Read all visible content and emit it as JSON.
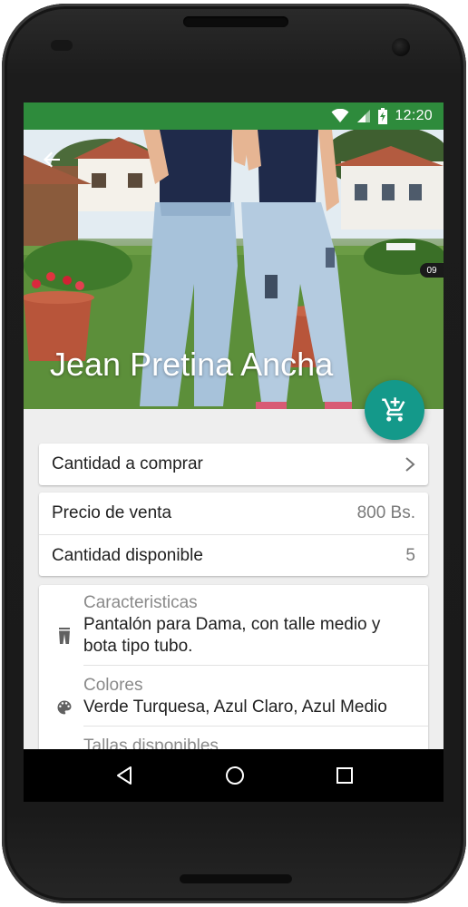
{
  "status_bar": {
    "time": "12:20",
    "icons": [
      "wifi-icon",
      "cell-signal-icon",
      "battery-charging-icon"
    ]
  },
  "product": {
    "title": "Jean Pretina Ancha",
    "photo_counter": "09"
  },
  "purchase": {
    "quantity_label": "Cantidad a comprar"
  },
  "pricing": {
    "price_label": "Precio de venta",
    "price_value": "800 Bs.",
    "stock_label": "Cantidad disponible",
    "stock_value": "5"
  },
  "features": [
    {
      "label": "Caracteristicas",
      "text": "Pantalón para Dama, con talle medio y bota tipo tubo.",
      "icon": "pants-icon"
    },
    {
      "label": "Colores",
      "text": "Verde Turquesa, Azul Claro, Azul Medio",
      "icon": "palette-icon"
    },
    {
      "label": "Tallas disponibles",
      "text": "",
      "icon": "size-icon"
    }
  ],
  "fab": {
    "icon": "add-to-cart-icon"
  },
  "navigation": {
    "icons": [
      "back-icon",
      "home-icon",
      "recents-icon"
    ]
  },
  "colors": {
    "status_bar": "#2e8b3c",
    "fab": "#14998a"
  }
}
